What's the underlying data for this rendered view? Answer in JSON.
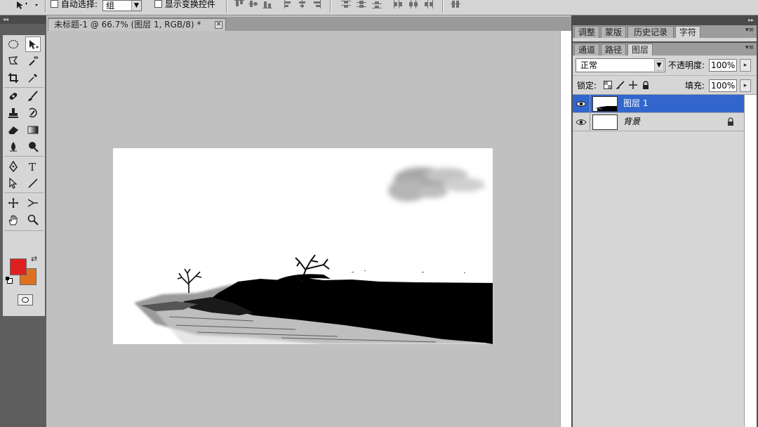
{
  "options_bar": {
    "tool_preset_icon": "move-tool-icon",
    "auto_select_label": "自动选择:",
    "auto_select_checked": false,
    "auto_select_target": "组",
    "show_transform_label": "显示变换控件",
    "show_transform_checked": false,
    "align_icons": [
      "align-top-icon",
      "align-vcenter-icon",
      "align-bottom-icon",
      "align-left-icon",
      "align-hcenter-icon",
      "align-right-icon",
      "distribute-top-icon",
      "distribute-vcenter-icon",
      "distribute-bottom-icon",
      "distribute-left-icon",
      "distribute-hcenter-icon",
      "distribute-right-icon",
      "auto-align-icon"
    ]
  },
  "document": {
    "tab_title": "未标题-1 @ 66.7% (图层 1, RGB/8) *",
    "close_label": "✕"
  },
  "toolbox": {
    "collapse_label": "◂◂",
    "tools": [
      "elliptical-marquee-icon",
      "move-icon",
      "lasso-icon",
      "magic-wand-icon",
      "crop-icon",
      "eyedropper-icon",
      "healing-brush-icon",
      "brush-icon",
      "clone-stamp-icon",
      "history-brush-icon",
      "eraser-icon",
      "gradient-icon",
      "blur-icon",
      "dodge-icon",
      "pen-icon",
      "type-icon",
      "path-selection-icon",
      "line-icon",
      "3d-rotate-icon",
      "3d-orbit-icon",
      "hand-icon",
      "zoom-icon"
    ],
    "type_tool_glyph": "T",
    "foreground_color": "#e02020",
    "background_color": "#e07020"
  },
  "panels": {
    "collapse_label": "▸▸",
    "top_tabs": [
      "调整",
      "蒙版",
      "历史记录",
      "字符"
    ],
    "top_active": "字符",
    "layer_tabs": [
      "通道",
      "路径",
      "图层"
    ],
    "layer_active": "图层",
    "menu_glyph": "▾≡",
    "blend_mode": "正常",
    "opacity_label": "不透明度:",
    "opacity_value": "100%",
    "lock_label": "锁定:",
    "fill_label": "填充:",
    "fill_value": "100%",
    "layers": [
      {
        "name": "图层 1",
        "selected": true,
        "visible": true,
        "italic": false,
        "locked": false
      },
      {
        "name": "背景",
        "selected": false,
        "visible": true,
        "italic": true,
        "locked": true
      }
    ]
  },
  "colors": {
    "selection_blue": "#3366cc",
    "panel_gray": "#d6d6d6",
    "workspace_gray": "#c0c0c0"
  }
}
